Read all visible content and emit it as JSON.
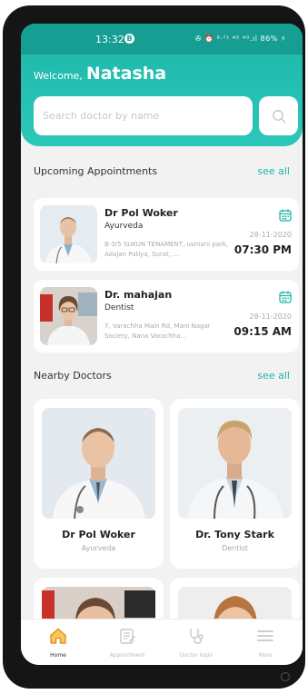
{
  "status_bar": {
    "time": "13:32",
    "indicator": "B",
    "right_icons": "✇ ⏰ ⁸·⁷¹ ⁴ᴳ ⁴ᴳ.ıl 86% ⚡"
  },
  "header": {
    "welcome_label": "Welcome,",
    "user_name": "Natasha"
  },
  "search": {
    "placeholder": "Search doctor by name",
    "icon": "search-icon"
  },
  "appointments": {
    "title": "Upcoming Appointments",
    "see_all": "see all",
    "items": [
      {
        "name": "Dr Pol Woker",
        "speciality": "Ayurveda",
        "address": "B-3/5 SUKUN TENAMENT, usmani park, Adajan Patiya, Surat, ...",
        "date": "28-11-2020",
        "time": "07:30 PM"
      },
      {
        "name": "Dr. mahajan",
        "speciality": "Dentist",
        "address": "7, Varachha Main Rd, Mani Nagar Society, Nana Varachha...",
        "date": "28-11-2020",
        "time": "09:15 AM"
      }
    ]
  },
  "nearby": {
    "title": "Nearby Doctors",
    "see_all": "see all",
    "doctors": [
      {
        "name": "Dr Pol Woker",
        "speciality": "Ayurveda"
      },
      {
        "name": "Dr. Tony Stark",
        "speciality": "Dentist"
      }
    ]
  },
  "nav": {
    "items": [
      {
        "label": "Home",
        "icon": "home-icon",
        "active": true
      },
      {
        "label": "Appointment",
        "icon": "appointment-icon",
        "active": false
      },
      {
        "label": "Doctor login",
        "icon": "stethoscope-icon",
        "active": false
      },
      {
        "label": "More",
        "icon": "menu-icon",
        "active": false
      }
    ]
  },
  "colors": {
    "accent": "#1fb5a8",
    "header_dark": "#169e92",
    "background": "#f2f2f2"
  }
}
